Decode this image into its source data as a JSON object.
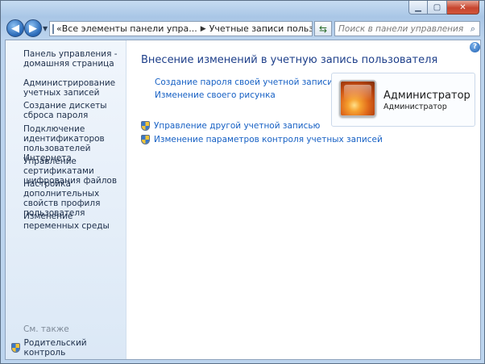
{
  "window": {
    "caption_buttons": [
      "minimize",
      "maximize",
      "close"
    ]
  },
  "nav": {
    "address_segments": [
      "«",
      "Все элементы панели упра...",
      "Учетные записи пользователей"
    ],
    "search_placeholder": "Поиск в панели управления"
  },
  "sidebar": {
    "items": [
      {
        "label": "Панель управления - домашняя страница"
      },
      {
        "label": "Администрирование учетных записей"
      },
      {
        "label": "Создание дискеты сброса пароля"
      },
      {
        "label": "Подключение идентификаторов пользователей Интернета"
      },
      {
        "label": "Управление сертификатами шифрования файлов"
      },
      {
        "label": "Настройка дополнительных свойств профиля пользователя"
      },
      {
        "label": "Изменение переменных среды"
      }
    ],
    "see_also": "См. также",
    "parental_control": "Родительский контроль"
  },
  "main": {
    "heading": "Внесение изменений в учетную запись пользователя",
    "links": [
      "Создание пароля своей учетной записи",
      "Изменение своего рисунка"
    ],
    "shield_links": [
      "Управление другой учетной записью",
      "Изменение параметров контроля учетных записей"
    ]
  },
  "user": {
    "name": "Администратор",
    "role": "Администратор"
  },
  "colors": {
    "link": "#1660c4",
    "heading": "#1e3f8a",
    "frame": "#a9c6e6"
  }
}
